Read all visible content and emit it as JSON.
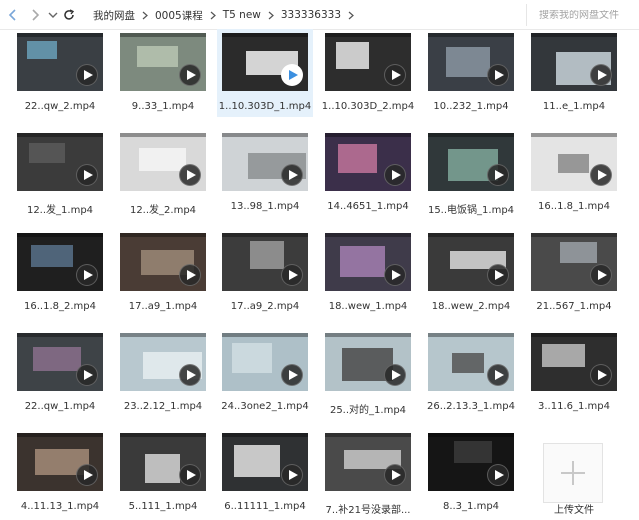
{
  "nav": {
    "back_icon": "chevron-left-icon",
    "forward_icon": "chevron-right-icon",
    "dropdown_icon": "chevron-down-icon",
    "refresh_icon": "refresh-icon"
  },
  "breadcrumb": [
    "我的网盘",
    "0005课程",
    "T5 new",
    "333336333"
  ],
  "search": {
    "placeholder": "搜索我的网盘文件"
  },
  "files": [
    {
      "name": "22..qw_2.mp4",
      "bg": "#3a3f44",
      "accent": "#6aa0b8"
    },
    {
      "name": "9..33_1.mp4",
      "bg": "#7d8a7e",
      "accent": "#b7c4b2"
    },
    {
      "name": "1..10.303D_1.mp4",
      "bg": "#2b2b2b",
      "accent": "#f2f2f2",
      "selected": true,
      "play_color": "#3b8fe0"
    },
    {
      "name": "1..10.303D_2.mp4",
      "bg": "#2d2d2d",
      "accent": "#e8e8e8"
    },
    {
      "name": "10..232_1.mp4",
      "bg": "#3a3f46",
      "accent": "#8a95a1"
    },
    {
      "name": "11..e_1.mp4",
      "bg": "#33373b",
      "accent": "#c9d3db"
    },
    {
      "name": "12..发_1.mp4",
      "bg": "#3b3b3b",
      "accent": "#5a5a5a"
    },
    {
      "name": "12..发_2.mp4",
      "bg": "#d9d9d9",
      "accent": "#f5f5f5"
    },
    {
      "name": "13..98_1.mp4",
      "bg": "#cfd3d6",
      "accent": "#8c8f92"
    },
    {
      "name": "14..4651_1.mp4",
      "bg": "#3b2f4a",
      "accent": "#c1739a"
    },
    {
      "name": "15..电饭锅_1.mp4",
      "bg": "#30383a",
      "accent": "#7fa79a"
    },
    {
      "name": "16..1.8_1.mp4",
      "bg": "#e4e4e4",
      "accent": "#8a8a8a"
    },
    {
      "name": "16..1.8_2.mp4",
      "bg": "#1f1f1f",
      "accent": "#58718a"
    },
    {
      "name": "17..a9_1.mp4",
      "bg": "#4a3c35",
      "accent": "#9b8877"
    },
    {
      "name": "17..a9_2.mp4",
      "bg": "#3c3c3c",
      "accent": "#9a9a9a"
    },
    {
      "name": "18..wew_1.mp4",
      "bg": "#3f3b4a",
      "accent": "#a37fb0"
    },
    {
      "name": "18..wew_2.mp4",
      "bg": "#3a3a3a",
      "accent": "#dcdcdc"
    },
    {
      "name": "21..567_1.mp4",
      "bg": "#4a4a4a",
      "accent": "#9aa0a6"
    },
    {
      "name": "22..qw_1.mp4",
      "bg": "#3e4347",
      "accent": "#8a6f8c"
    },
    {
      "name": "23..2.12_1.mp4",
      "bg": "#b8c8cf",
      "accent": "#e5edf0"
    },
    {
      "name": "24..3one2_1.mp4",
      "bg": "#aec0c8",
      "accent": "#d0dde2"
    },
    {
      "name": "25..对的_1.mp4",
      "bg": "#b3c2c8",
      "accent": "#4a4a4a"
    },
    {
      "name": "26..2.13.3_1.mp4",
      "bg": "#b6c6cc",
      "accent": "#555555"
    },
    {
      "name": "3..11.6_1.mp4",
      "bg": "#2e2e2e",
      "accent": "#bdbdbd"
    },
    {
      "name": "4..11.13_1.mp4",
      "bg": "#3b332e",
      "accent": "#a48c78"
    },
    {
      "name": "5..111_1.mp4",
      "bg": "#3a3a3a",
      "accent": "#d6d6d6"
    },
    {
      "name": "6..11111_1.mp4",
      "bg": "#2f3133",
      "accent": "#e3e3e3"
    },
    {
      "name": "7..补21号没录部...",
      "bg": "#4a4a4a",
      "accent": "#c8c8c8"
    },
    {
      "name": "8..3_1.mp4",
      "bg": "#151515",
      "accent": "#3a3a3a"
    }
  ],
  "upload": {
    "label": "上传文件",
    "icon": "plus-icon"
  }
}
